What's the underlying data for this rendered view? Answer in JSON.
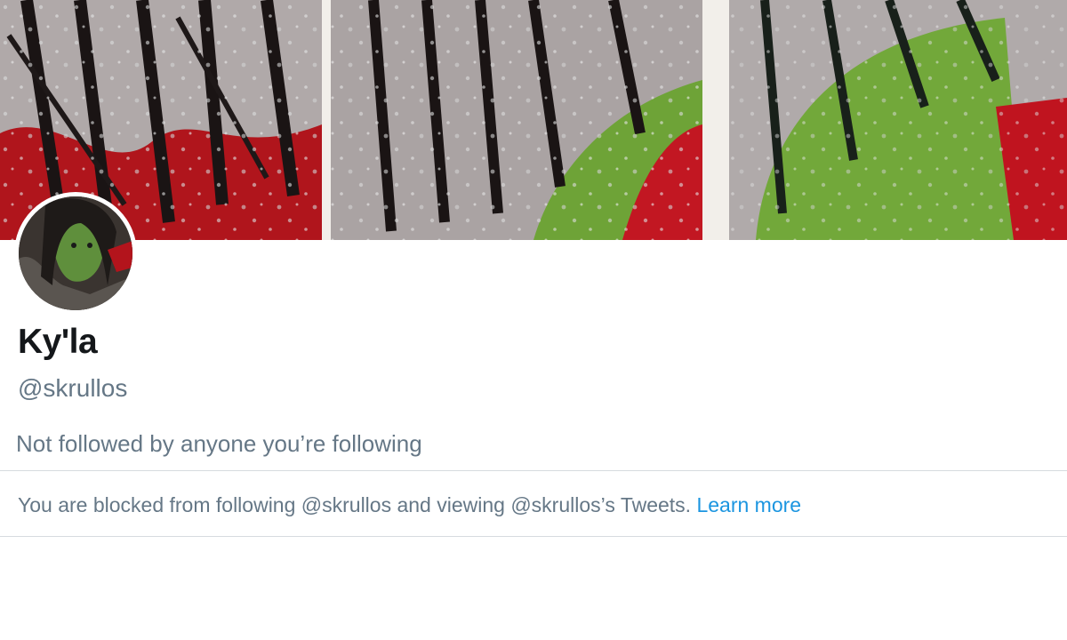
{
  "profile": {
    "display_name": "Ky'la",
    "handle": "@skrullos",
    "followers_note": "Not followed by anyone you’re following"
  },
  "blocked_notice": {
    "text": "You are blocked from following @skrullos and viewing @skrullos’s Tweets.",
    "link_label": "Learn more"
  },
  "colors": {
    "name": "#14171a",
    "secondary_text": "#657786",
    "link": "#1b95e0",
    "divider": "#d6dbdf"
  }
}
